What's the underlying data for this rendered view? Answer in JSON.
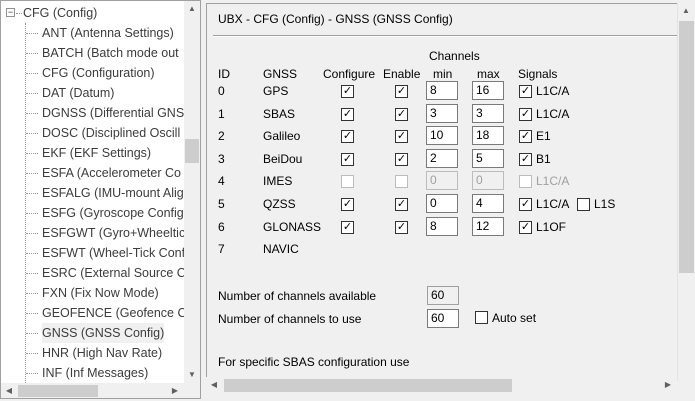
{
  "tree": {
    "root_label": "CFG (Config)",
    "items": [
      {
        "label": "ANT (Antenna Settings)"
      },
      {
        "label": "BATCH (Batch mode out"
      },
      {
        "label": "CFG (Configuration)"
      },
      {
        "label": "DAT (Datum)"
      },
      {
        "label": "DGNSS (Differential GNS"
      },
      {
        "label": "DOSC (Disciplined Oscill"
      },
      {
        "label": "EKF (EKF Settings)"
      },
      {
        "label": "ESFA (Accelerometer Co"
      },
      {
        "label": "ESFALG (IMU-mount Alig"
      },
      {
        "label": "ESFG (Gyroscope Config"
      },
      {
        "label": "ESFGWT (Gyro+Wheeltic"
      },
      {
        "label": "ESFWT (Wheel-Tick Conf"
      },
      {
        "label": "ESRC (External Source C"
      },
      {
        "label": "FXN (Fix Now Mode)"
      },
      {
        "label": "GEOFENCE (Geofence Co"
      },
      {
        "label": "GNSS (GNSS Config)"
      },
      {
        "label": "HNR (High Nav Rate)"
      },
      {
        "label": "INF (Inf Messages)"
      }
    ],
    "selected_index": 15
  },
  "panel": {
    "title": "UBX - CFG (Config) - GNSS (GNSS Config)",
    "headers": {
      "id": "ID",
      "gnss": "GNSS",
      "configure": "Configure",
      "enable": "Enable",
      "channels": "Channels",
      "min": "min",
      "max": "max",
      "signals": "Signals"
    },
    "rows": [
      {
        "id": "0",
        "gnss": "GPS",
        "configure": true,
        "enable": true,
        "min": "8",
        "max": "16",
        "signals": [
          {
            "label": "L1C/A",
            "checked": true
          }
        ],
        "disabled": false
      },
      {
        "id": "1",
        "gnss": "SBAS",
        "configure": true,
        "enable": true,
        "min": "3",
        "max": "3",
        "signals": [
          {
            "label": "L1C/A",
            "checked": true
          }
        ],
        "disabled": false
      },
      {
        "id": "2",
        "gnss": "Galileo",
        "configure": true,
        "enable": true,
        "min": "10",
        "max": "18",
        "signals": [
          {
            "label": "E1",
            "checked": true
          }
        ],
        "disabled": false
      },
      {
        "id": "3",
        "gnss": "BeiDou",
        "configure": true,
        "enable": true,
        "min": "2",
        "max": "5",
        "signals": [
          {
            "label": "B1",
            "checked": true
          }
        ],
        "disabled": false
      },
      {
        "id": "4",
        "gnss": "IMES",
        "configure": false,
        "enable": false,
        "min": "0",
        "max": "0",
        "signals": [
          {
            "label": "L1C/A",
            "checked": false
          }
        ],
        "disabled": true
      },
      {
        "id": "5",
        "gnss": "QZSS",
        "configure": true,
        "enable": true,
        "min": "0",
        "max": "4",
        "signals": [
          {
            "label": "L1C/A",
            "checked": true
          },
          {
            "label": "L1S",
            "checked": false
          }
        ],
        "disabled": false
      },
      {
        "id": "6",
        "gnss": "GLONASS",
        "configure": true,
        "enable": true,
        "min": "8",
        "max": "12",
        "signals": [
          {
            "label": "L1OF",
            "checked": true
          }
        ],
        "disabled": false
      },
      {
        "id": "7",
        "gnss": "NAVIC"
      }
    ],
    "channels_available_label": "Number of channels available",
    "channels_available_value": "60",
    "channels_to_use_label": "Number of channels to use",
    "channels_to_use_value": "60",
    "auto_set_label": "Auto set",
    "auto_set_checked": false,
    "sbas_note": "For specific SBAS configuration use"
  },
  "icons": {
    "check": "checkmark-icon",
    "expand": "tree-collapse-icon"
  }
}
